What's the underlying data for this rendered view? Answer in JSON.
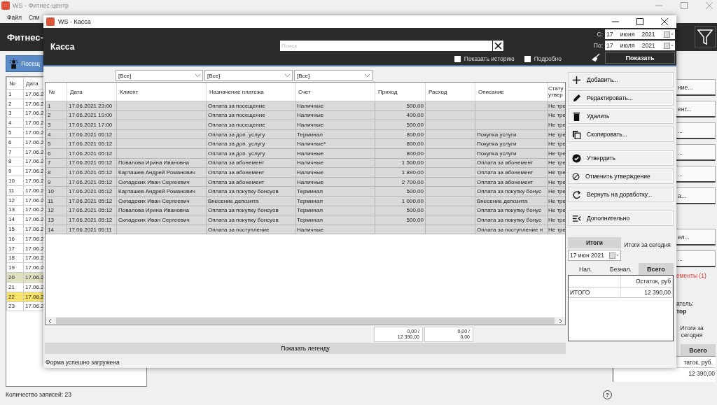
{
  "app": {
    "title": "WS - Фитнес-центр",
    "menu": [
      "Файл",
      "Спи"
    ],
    "header": "Фитнес-",
    "visits_button": "Посещ",
    "table": {
      "columns": [
        "№",
        "Дата"
      ],
      "rows": [
        {
          "cells": [
            "1",
            "17.06.2"
          ],
          "color": "#ffffff"
        },
        {
          "cells": [
            "2",
            "17.06.2"
          ],
          "color": "#ffffff"
        },
        {
          "cells": [
            "3",
            "17.06.2"
          ],
          "color": "#ffffff"
        },
        {
          "cells": [
            "4",
            "17.06.2"
          ],
          "color": "#ffffff"
        },
        {
          "cells": [
            "5",
            "17.06.2"
          ],
          "color": "#ffffff"
        },
        {
          "cells": [
            "6",
            "17.06.2"
          ],
          "color": "#ffffff"
        },
        {
          "cells": [
            "7",
            "17.06.2"
          ],
          "color": "#ffffff"
        },
        {
          "cells": [
            "8",
            "17.06.2"
          ],
          "color": "#ffffff"
        },
        {
          "cells": [
            "9",
            "17.06.2"
          ],
          "color": "#ffffff"
        },
        {
          "cells": [
            "10",
            "17.06.2"
          ],
          "color": "#ffffff"
        },
        {
          "cells": [
            "11",
            "17.06.2"
          ],
          "color": "#ffffff"
        },
        {
          "cells": [
            "12",
            "17.06.2"
          ],
          "color": "#ffffff"
        },
        {
          "cells": [
            "13",
            "17.06.2"
          ],
          "color": "#ffffff"
        },
        {
          "cells": [
            "14",
            "17.06.2"
          ],
          "color": "#ffffff"
        },
        {
          "cells": [
            "15",
            "17.06.2"
          ],
          "color": "#ffffff"
        },
        {
          "cells": [
            "16",
            "17.06.2"
          ],
          "color": "#ffffff"
        },
        {
          "cells": [
            "17",
            "17.06.2"
          ],
          "color": "#ffffff"
        },
        {
          "cells": [
            "18",
            "17.06.2"
          ],
          "color": "#ffffff"
        },
        {
          "cells": [
            "19",
            "17.06.2"
          ],
          "color": "#ffffff"
        },
        {
          "cells": [
            "20",
            "17.06.2"
          ],
          "color": "#dfe0c0"
        },
        {
          "cells": [
            "21",
            "17.06.2"
          ],
          "color": "#ffffff"
        },
        {
          "cells": [
            "22",
            "17.06.2"
          ],
          "color": "#f7e36b"
        },
        {
          "cells": [
            "23",
            "17.06.2"
          ],
          "color": "#ffffff"
        }
      ]
    },
    "right_panel": {
      "buttons": [
        "ние...",
        "ент...",
        "...",
        "...",
        "...",
        "а...",
        "ел...",
        "..."
      ],
      "warning": "ементы (1)",
      "user_label": "атель:",
      "user_name": "тор",
      "caption": "Итоги за сегодня",
      "total_tab": "Всего",
      "balance_header": "таток, руб.",
      "balance_value": "12 390,00"
    },
    "record_count": "Количество записей: 23",
    "help": "?"
  },
  "dialog": {
    "title": "WS - Касса",
    "heading": "Касса",
    "search": {
      "placeholder": "Поиск"
    },
    "options": [
      {
        "label": "Показать историю",
        "checked": false
      },
      {
        "label": "Подробно",
        "checked": false
      }
    ],
    "from_label": "С:",
    "from_date": "17 июня 2021",
    "to_label": "По:",
    "to_date": "17 июля 2021",
    "show_button": "Показать",
    "filters": [
      "[Все]",
      "[Все]",
      "[Все]"
    ],
    "columns": [
      "№",
      "Дата",
      "Клиент",
      "Назначение платежа",
      "Счет",
      "Приход",
      "Расход",
      "Описание",
      "Стату утвер"
    ],
    "rows": [
      [
        "1",
        "17.06.2021 23:00",
        "",
        "Оплата за посещение",
        "Наличные",
        "500,00",
        "",
        "",
        "Не тре"
      ],
      [
        "2",
        "17.06.2021 19:00",
        "",
        "Оплата за посещение",
        "Наличные",
        "400,00",
        "",
        "",
        "Не тре"
      ],
      [
        "3",
        "17.06.2021 17:00",
        "",
        "Оплата за посещение",
        "Наличные",
        "500,00",
        "",
        "",
        "Не тре"
      ],
      [
        "4",
        "17.06.2021 05:12",
        "",
        "Оплата за доп. услугу",
        "Терминал",
        "800,00",
        "",
        "Покупка услуги",
        "Не тре"
      ],
      [
        "5",
        "17.06.2021 05:12",
        "",
        "Оплата за доп. услугу",
        "Наличные*",
        "800,00",
        "",
        "Покупка услуги",
        "Не тре"
      ],
      [
        "6",
        "17.06.2021 05:12",
        "",
        "Оплата за доп. услугу",
        "Наличные",
        "800,00",
        "",
        "Покупка услуги",
        "Не тре"
      ],
      [
        "7",
        "17.06.2021 05:12",
        "Повалова Ирина Ивановна",
        "Оплата за абонемент",
        "Наличные",
        "1 500,00",
        "",
        "Оплата за абонемент",
        "Не тре"
      ],
      [
        "8",
        "17.06.2021 05:12",
        "Карташев Андрей Романович",
        "Оплата за абонемент",
        "Наличные",
        "1 890,00",
        "",
        "Оплата за абонемент",
        "Не тре"
      ],
      [
        "9",
        "17.06.2021 05:12",
        "Складских Иван Сергеевич",
        "Оплата за абонемент",
        "Наличные",
        "2 700,00",
        "",
        "Оплата за абонемент",
        "Не тре"
      ],
      [
        "10",
        "17.06.2021 05:12",
        "Карташев Андрей Романович",
        "Оплата за покупку бонсуов",
        "Терминал",
        "500,00",
        "",
        "Оплата за покупку бонус",
        "Не тре"
      ],
      [
        "11",
        "17.06.2021 05:12",
        "Складских Иван Сергеевич",
        "Внесение депозита",
        "Терминал",
        "1 000,00",
        "",
        "Внесение депозита",
        "Не тре"
      ],
      [
        "12",
        "17.06.2021 05:12",
        "Повалова Ирина Ивановна",
        "Оплата за покупку бонсуов",
        "Терминал",
        "500,00",
        "",
        "Оплата за покупку бонус",
        "Не тре"
      ],
      [
        "13",
        "17.06.2021 05:12",
        "Складских Иван Сергеевич",
        "Оплата за покупку бонсуов",
        "Терминал",
        "500,00",
        "",
        "Оплата за покупку бонус",
        "Не тре"
      ],
      [
        "14",
        "17.06.2021 05:11",
        "",
        "Оплата за поступление",
        "Наличные",
        "",
        "",
        "Оплата за поступление н",
        "Не тре"
      ]
    ],
    "totals": [
      [
        "0,00 /",
        "12 390,00"
      ],
      [
        "0,00 /",
        "0,00"
      ]
    ],
    "legend_button": "Показать легенду",
    "actions": [
      {
        "kind": "add",
        "label": "Добавить..."
      },
      {
        "kind": "edit",
        "label": "Редактировать..."
      },
      {
        "kind": "delete",
        "label": "Удалить"
      },
      {
        "kind": "copy",
        "label": "Скопировать..."
      },
      {
        "kind": "approve",
        "label": "Утвердить"
      },
      {
        "kind": "cancel",
        "label": "Отменить утверждение"
      },
      {
        "kind": "return",
        "label": "Вернуть на доработку..."
      },
      {
        "kind": "more",
        "label": "Дополнительно"
      }
    ],
    "summary": {
      "tabs": [
        {
          "label": "Итоги",
          "selected": true
        },
        {
          "label": "Итоги за сегодня",
          "selected": false
        }
      ],
      "date": "17 июн 2021",
      "subtabs": [
        {
          "label": "Нал.",
          "selected": false
        },
        {
          "label": "Безнал.",
          "selected": false
        },
        {
          "label": "Всего",
          "selected": true
        }
      ],
      "columns": [
        "",
        "Остаток, руб"
      ],
      "rows": [
        [
          "ИТОГО",
          "12 390,00"
        ]
      ]
    },
    "status": "Форма успешно загружена"
  }
}
